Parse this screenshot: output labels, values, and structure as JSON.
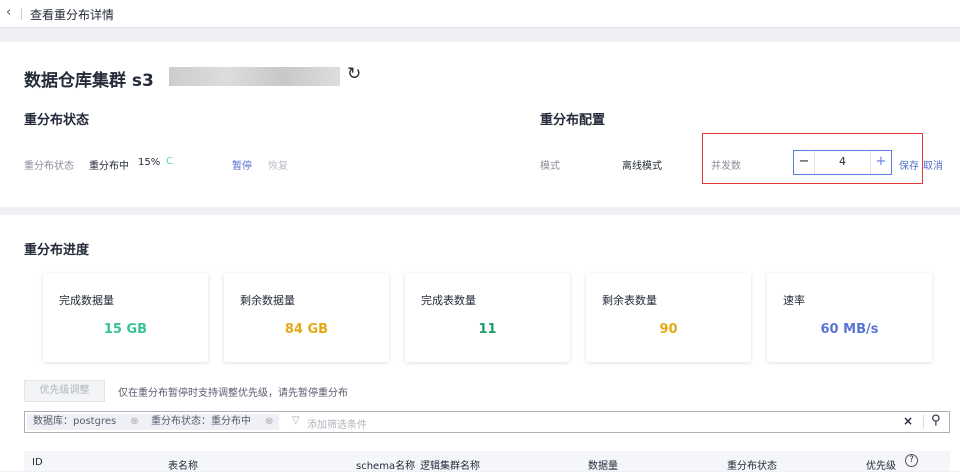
{
  "header": {
    "title": "查看重分布详情"
  },
  "cluster": {
    "title_prefix": "数据仓库集群 s3"
  },
  "status_section": {
    "heading": "重分布状态",
    "label": "重分布状态",
    "state": "重分布中",
    "percent": "15%",
    "pause": "暂停",
    "resume": "恢复"
  },
  "config_section": {
    "heading": "重分布配置",
    "mode_label": "模式",
    "mode_value": "离线模式",
    "concurrency_label": "并发数",
    "concurrency_value": "4",
    "save": "保存",
    "cancel": "取消"
  },
  "progress": {
    "heading": "重分布进度",
    "cards": [
      {
        "label": "完成数据量",
        "value": "15 GB",
        "color": "#3ac295"
      },
      {
        "label": "剩余数据量",
        "value": "84 GB",
        "color": "#e6a817"
      },
      {
        "label": "完成表数量",
        "value": "11",
        "color": "#1e9e6a"
      },
      {
        "label": "剩余表数量",
        "value": "90",
        "color": "#e6a817"
      },
      {
        "label": "速率",
        "value": "60 MB/s",
        "color": "#5a74d6"
      }
    ]
  },
  "priority": {
    "button": "优先级调整",
    "hint": "仅在重分布暂停时支持调整优先级，请先暂停重分布"
  },
  "filter": {
    "tags": [
      "数据库：postgres",
      "重分布状态：重分布中"
    ],
    "placeholder": "添加筛选条件"
  },
  "table": {
    "columns": [
      "ID",
      "表名称",
      "schema名称",
      "逻辑集群名称",
      "数据量",
      "重分布状态",
      "优先级"
    ]
  }
}
